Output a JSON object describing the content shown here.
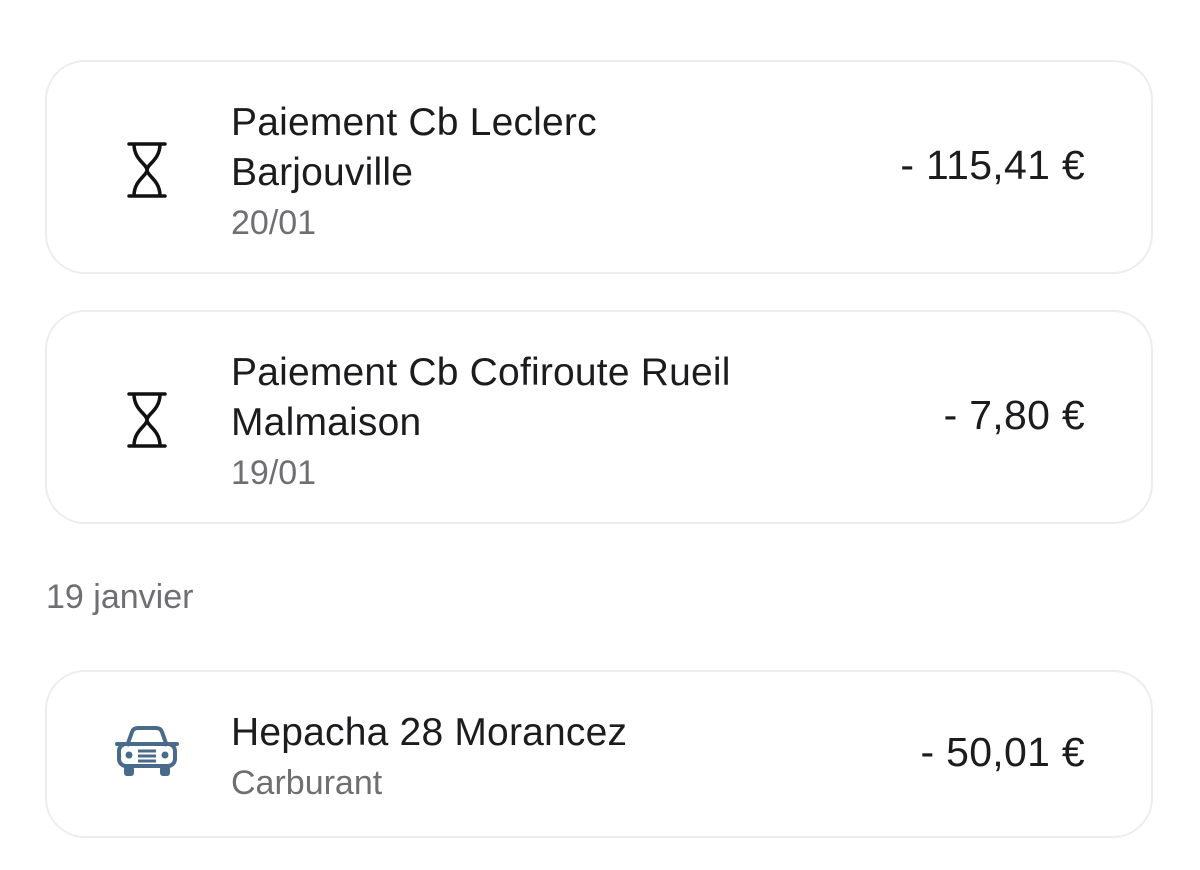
{
  "transactions_pending": [
    {
      "title_line1": "Paiement Cb Leclerc",
      "title_line2": "Barjouville",
      "date": "20/01",
      "amount": "- 115,41 €",
      "icon": "hourglass-icon"
    },
    {
      "title_line1": "Paiement Cb Cofiroute Rueil",
      "title_line2": "Malmaison",
      "date": "19/01",
      "amount": "- 7,80 €",
      "icon": "hourglass-icon"
    }
  ],
  "section_header": "19 janvier",
  "transactions": [
    {
      "title": "Hepacha 28 Morancez",
      "category": "Carburant",
      "amount": "- 50,01 €",
      "icon": "car-icon",
      "icon_color": "#4a6a8c"
    }
  ]
}
